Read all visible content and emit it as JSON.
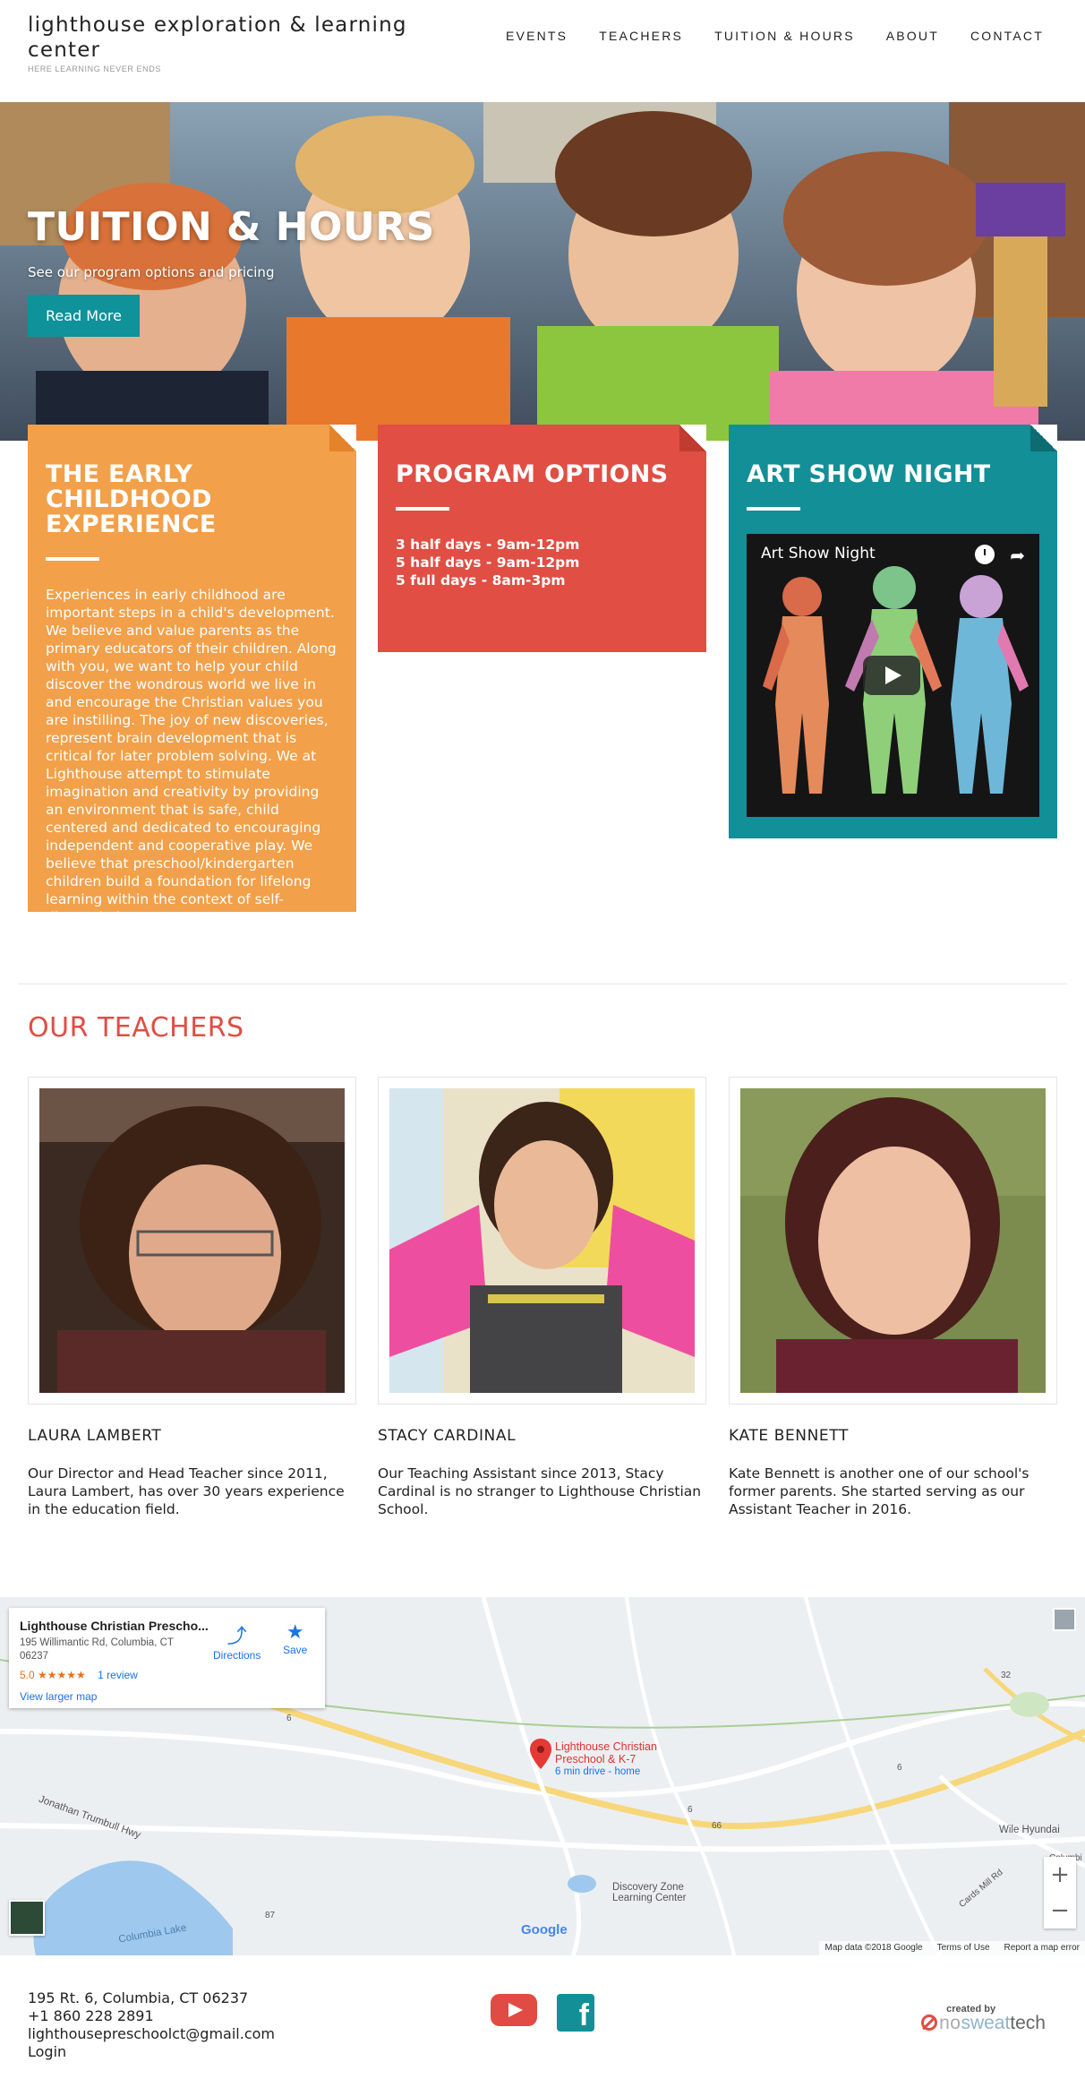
{
  "header": {
    "brand_title": "lighthouse exploration & learning center",
    "brand_tagline": "HERE LEARNING NEVER ENDS",
    "nav": [
      "EVENTS",
      "TEACHERS",
      "TUITION & HOURS",
      "ABOUT",
      "CONTACT"
    ]
  },
  "hero": {
    "title": "TUITION & HOURS",
    "subtitle": "See our program options and pricing",
    "button": "Read More"
  },
  "cards": {
    "early": {
      "title": "THE EARLY CHILDHOOD EXPERIENCE",
      "body": "Experiences in early childhood are important steps in a child's development. We believe and value parents as the primary educators of their children. Along with you, we want to help your child discover the wondrous world we live in and encourage the Christian values you are instilling. The joy of new discoveries, represent brain development that is critical for later problem solving. We at Lighthouse attempt to stimulate imagination and creativity by providing an environment that is safe, child centered and dedicated to encouraging independent and cooperative play. We believe that preschool/kindergarten children build a foundation for lifelong learning within the context of self-directed play."
    },
    "programs": {
      "title": "PROGRAM OPTIONS",
      "items": [
        "3 half days - 9am-12pm",
        "5 half days - 9am-12pm",
        "5 full days - 8am-3pm"
      ]
    },
    "art": {
      "title": "ART SHOW NIGHT",
      "video_title": "Art Show Night"
    }
  },
  "teachers": {
    "title": "OUR TEACHERS",
    "list": [
      {
        "name": "LAURA LAMBERT",
        "bio": "Our Director and Head Teacher since 2011, Laura Lambert, has over 30 years experience in the education field."
      },
      {
        "name": "STACY CARDINAL",
        "bio": "Our Teaching Assistant since 2013, Stacy Cardinal is no stranger to Lighthouse Christian School."
      },
      {
        "name": "KATE BENNETT",
        "bio": "Kate Bennett is another one of our school's former parents. She started serving as our Assistant Teacher in 2016."
      }
    ]
  },
  "map": {
    "place_name": "Lighthouse Christian Prescho...",
    "address": "195 Willimantic Rd, Columbia, CT 06237",
    "rating": "5.0 ★★★★★",
    "reviews": "1 review",
    "larger_map": "View larger map",
    "directions": "Directions",
    "save": "Save",
    "pin_label_1": "Lighthouse Christian",
    "pin_label_2": "Preschool & K-7",
    "pin_sub": "6 min drive - home",
    "labels": {
      "discovery_1": "Discovery Zone",
      "discovery_2": "Learning Center",
      "wile": "Wile Hyundai",
      "lake": "Columbia Lake",
      "trumbull": "Jonathan Trumbull Hwy",
      "cards_mill": "Cards Mill Rd",
      "columbia": "Columbi",
      "r6a": "6",
      "r6b": "6",
      "r6c": "6",
      "r66": "66",
      "r87": "87",
      "r32": "32"
    },
    "google": "Google",
    "footer": [
      "Map data ©2018 Google",
      "Terms of Use",
      "Report a map error"
    ]
  },
  "footer": {
    "address": "195 Rt. 6, Columbia, CT 06237",
    "phone": "+1 860 228 2891",
    "email": "lighthousepreschoolct@gmail.com",
    "login": "Login",
    "credit_top": "created by",
    "credit_no": "no",
    "credit_sweat": "sweat",
    "credit_tech": "tech"
  }
}
